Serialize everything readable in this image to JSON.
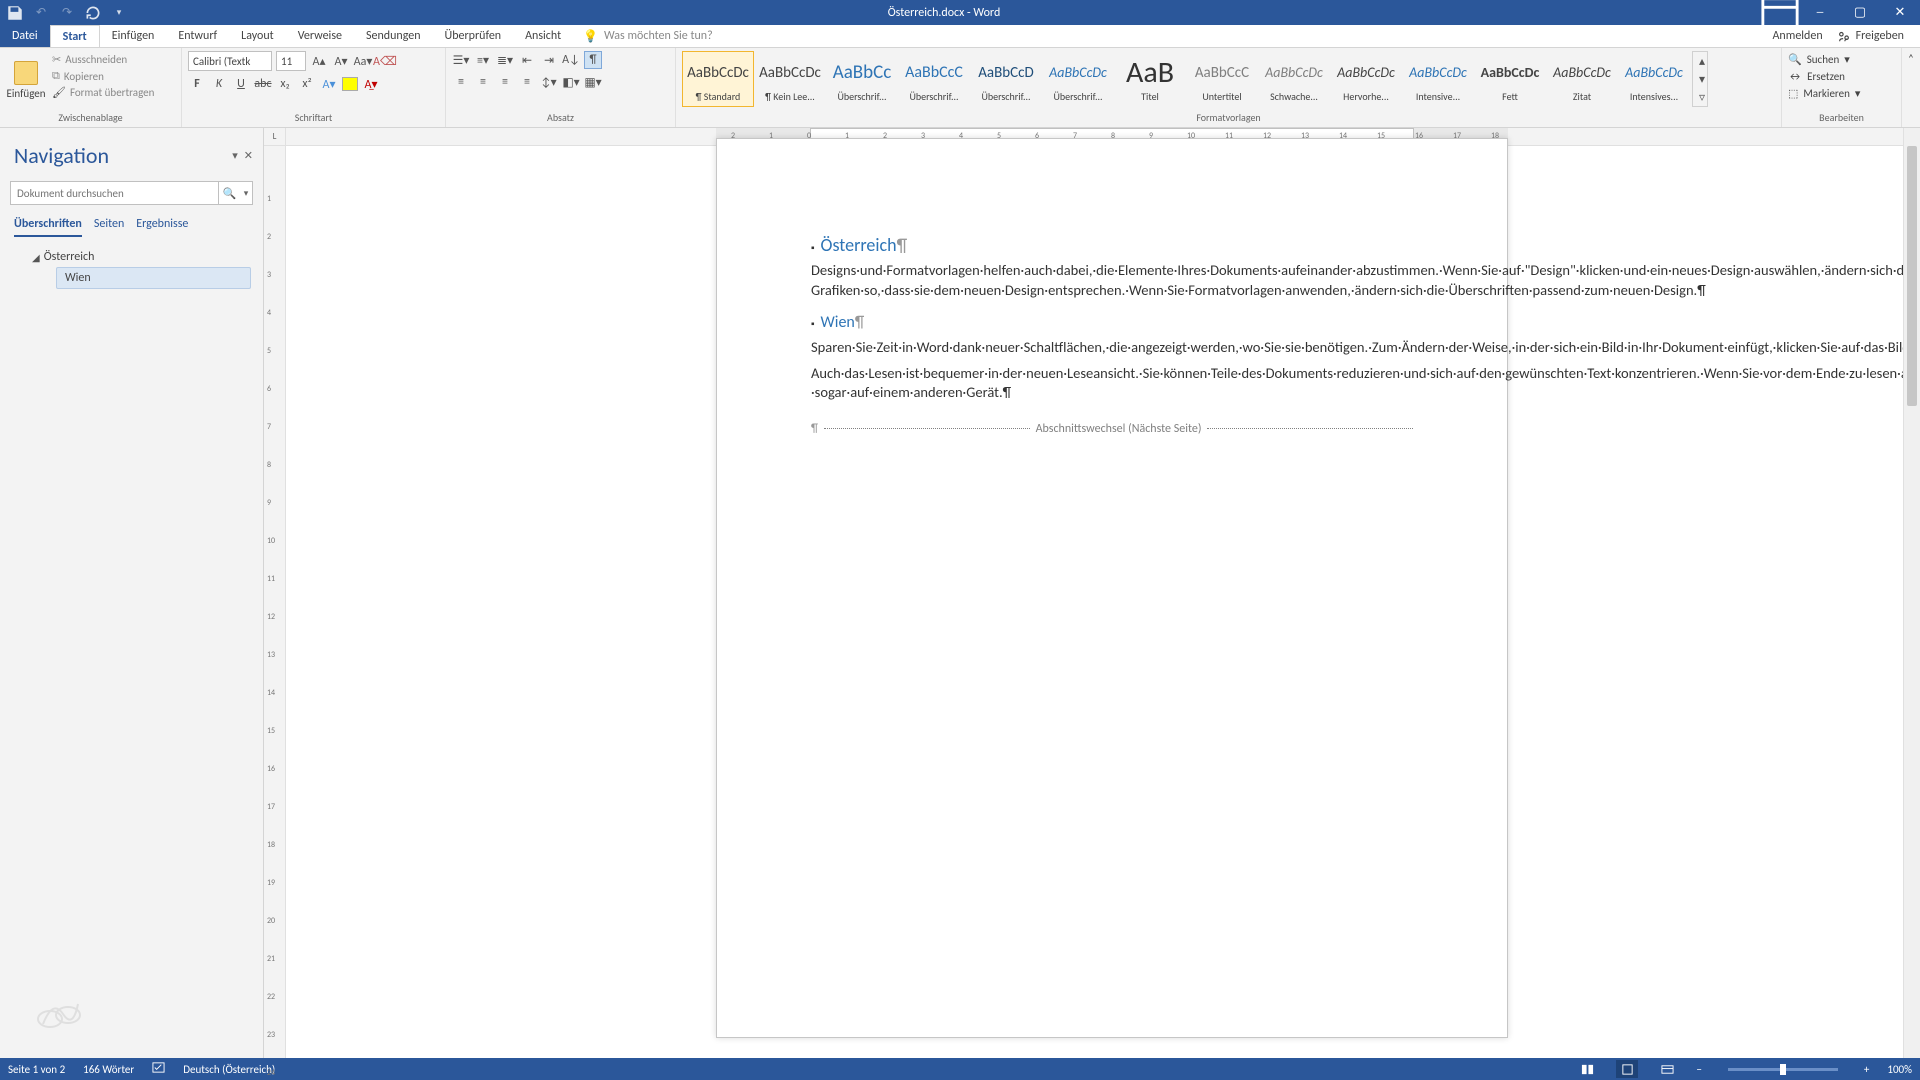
{
  "title": "Österreich.docx - Word",
  "qat": {
    "save": "💾",
    "undo": "↶",
    "redo": "↷",
    "refresh": "🔄"
  },
  "tabs": {
    "file": "Datei",
    "items": [
      "Start",
      "Einfügen",
      "Entwurf",
      "Layout",
      "Verweise",
      "Sendungen",
      "Überprüfen",
      "Ansicht"
    ],
    "active": "Start",
    "tellme_placeholder": "Was möchten Sie tun?",
    "signin": "Anmelden",
    "share": "Freigeben"
  },
  "ribbon": {
    "clipboard": {
      "label": "Zwischenablage",
      "paste": "Einfügen",
      "cut": "Ausschneiden",
      "copy": "Kopieren",
      "format_painter": "Format übertragen"
    },
    "font": {
      "label": "Schriftart",
      "name": "Calibri (Textk",
      "size": "11"
    },
    "paragraph": {
      "label": "Absatz"
    },
    "styles": {
      "label": "Formatvorlagen",
      "items": [
        {
          "preview": "AaBbCcDc",
          "label": "¶ Standard",
          "sel": true,
          "color": "#444",
          "size": "15px"
        },
        {
          "preview": "AaBbCcDc",
          "label": "¶ Kein Lee...",
          "color": "#444",
          "size": "15px"
        },
        {
          "preview": "AaBbCc",
          "label": "Überschrif...",
          "color": "#2e74b5",
          "size": "19px"
        },
        {
          "preview": "AaBbCcC",
          "label": "Überschrif...",
          "color": "#2e74b5",
          "size": "16px"
        },
        {
          "preview": "AaBbCcD",
          "label": "Überschrif...",
          "color": "#1f4e79",
          "size": "15px"
        },
        {
          "preview": "AaBbCcDc",
          "label": "Überschrif...",
          "color": "#2e74b5",
          "size": "14px",
          "italic": true
        },
        {
          "preview": "AaB",
          "label": "Titel",
          "color": "#333",
          "size": "30px"
        },
        {
          "preview": "AaBbCcC",
          "label": "Untertitel",
          "color": "#7f7f7f",
          "size": "15px"
        },
        {
          "preview": "AaBbCcDc",
          "label": "Schwache...",
          "color": "#7f7f7f",
          "size": "14px",
          "italic": true
        },
        {
          "preview": "AaBbCcDc",
          "label": "Hervorhe...",
          "color": "#444",
          "size": "14px",
          "italic": true
        },
        {
          "preview": "AaBbCcDc",
          "label": "Intensive...",
          "color": "#2e74b5",
          "size": "14px",
          "italic": true
        },
        {
          "preview": "AaBbCcDc",
          "label": "Fett",
          "color": "#444",
          "size": "14px",
          "bold": true
        },
        {
          "preview": "AaBbCcDc",
          "label": "Zitat",
          "color": "#444",
          "size": "14px",
          "italic": true
        },
        {
          "preview": "AaBbCcDc",
          "label": "Intensives...",
          "color": "#2e74b5",
          "size": "14px",
          "italic": true
        }
      ]
    },
    "editing": {
      "label": "Bearbeiten",
      "find": "Suchen",
      "replace": "Ersetzen",
      "select": "Markieren"
    }
  },
  "nav": {
    "title": "Navigation",
    "search_placeholder": "Dokument durchsuchen",
    "tabs": [
      "Überschriften",
      "Seiten",
      "Ergebnisse"
    ],
    "active_tab": "Überschriften",
    "root": "Österreich",
    "child": "Wien"
  },
  "ruler_corner": "L",
  "document": {
    "h1": "Österreich",
    "p1": "Designs·und·Formatvorlagen·helfen·auch·dabei,·die·Elemente·Ihres·Dokuments·aufeinander·abzustimmen.·Wenn·Sie·auf·\"Design\"·klicken·und·ein·neues·Design·auswählen,·ändern·sich·die·Grafiken,·Diagramme·und·SmartArt-Grafiken·so,·dass·sie·dem·neuen·Design·entsprechen.·Wenn·Sie·Formatvorlagen·anwenden,·ändern·sich·die·Überschriften·passend·zum·neuen·Design.¶",
    "h2": "Wien",
    "p2": "Sparen·Sie·Zeit·in·Word·dank·neuer·Schaltflächen,·die·angezeigt·werden,·wo·Sie·sie·benötigen.·Zum·Ändern·der·Weise,·in·der·sich·ein·Bild·in·Ihr·Dokument·einfügt,·klicken·Sie·auf·das·Bild.·Dann·wird·eine·Schaltfläche·für·Layoutoptionen·neben·dem·Bild·angezeigt·Beim·Arbeiten·an·einer·Tabelle·klicken·Sie·an·die·Position,·an·der·Sie·eine·Zeile·oder·Spalte·hinzufügen·möchten,·und·klicken·Sie·dann·auf·das·Pluszeichen.¶",
    "p3": "Auch·das·Lesen·ist·bequemer·in·der·neuen·Leseansicht.·Sie·können·Teile·des·Dokuments·reduzieren·und·sich·auf·den·gewünschten·Text·konzentrieren.·Wenn·Sie·vor·dem·Ende·zu·lesen·aufhören·müssen,·merkt·sich·Word·die·Stelle,·bis·zu·der·Sie·gelangt·sind·–·sogar·auf·einem·anderen·Gerät.¶",
    "section_break": "Abschnittswechsel (Nächste Seite)"
  },
  "status": {
    "page": "Seite 1 von 2",
    "words": "166 Wörter",
    "lang": "Deutsch (Österreich)",
    "zoom": "100%"
  }
}
